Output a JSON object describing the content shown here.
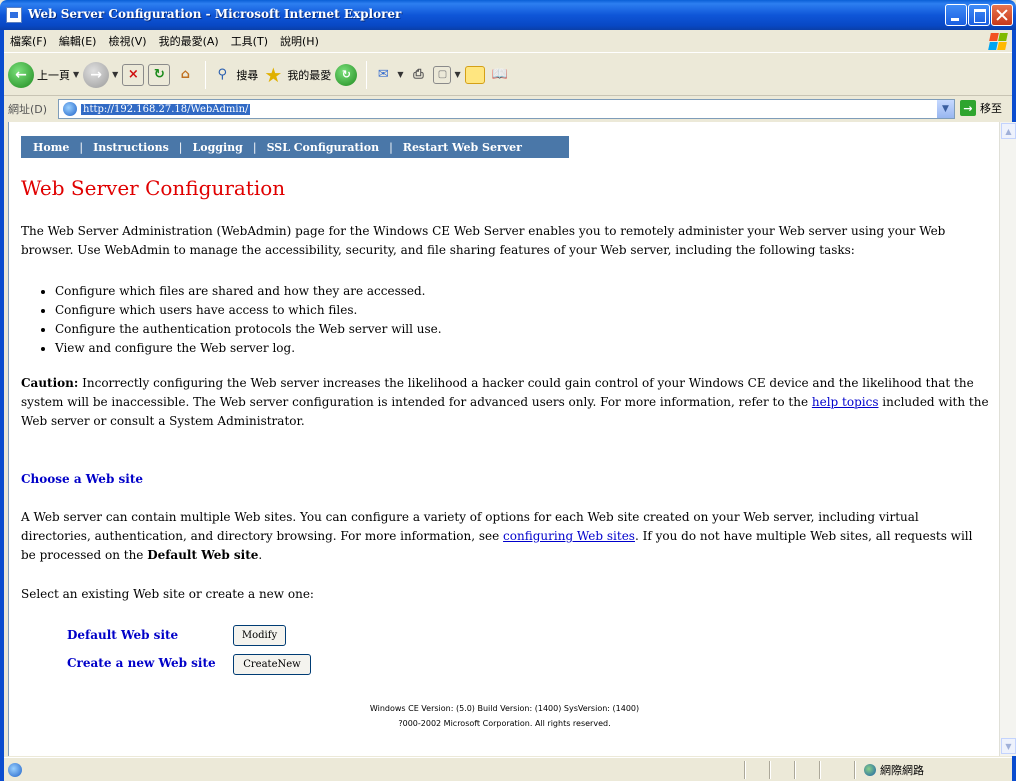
{
  "window": {
    "title": "Web Server Configuration - Microsoft Internet Explorer"
  },
  "menu": [
    "檔案(F)",
    "編輯(E)",
    "檢視(V)",
    "我的最愛(A)",
    "工具(T)",
    "說明(H)"
  ],
  "toolbar": {
    "back_label": "上一頁",
    "search_label": "搜尋",
    "favorites_label": "我的最愛"
  },
  "address": {
    "label": "網址(D)",
    "url": "http://192.168.27.18/WebAdmin/",
    "go_label": "移至"
  },
  "nav": [
    "Home",
    "Instructions",
    "Logging",
    "SSL Configuration",
    "Restart Web Server"
  ],
  "page": {
    "title": "Web Server Configuration",
    "intro": "The Web Server Administration (WebAdmin) page for the Windows CE Web Server enables you to remotely administer your Web server using your Web browser. Use WebAdmin to manage the accessibility, security, and file sharing features of your Web server, including the following tasks:",
    "tasks": [
      "Configure which files are shared and how they are accessed.",
      "Configure which users have access to which files.",
      "Configure the authentication protocols the Web server will use.",
      "View and configure the Web server log."
    ],
    "caution_label": "Caution:",
    "caution_text": " Incorrectly configuring the Web server increases the likelihood a hacker could gain control of your Windows CE device and the likelihood that the system will be inaccessible. The Web server configuration is intended for advanced users only. For more information, refer to the ",
    "caution_link": "help topics",
    "caution_tail": " included with the Web server or consult a System Administrator.",
    "choose_heading": "Choose a Web site",
    "choose_text_1": "A Web server can contain multiple Web sites. You can configure a variety of options for each Web site created on your Web server, including virtual directories, authentication, and directory browsing. For more information, see ",
    "choose_link": "configuring Web sites",
    "choose_text_2": ". If you do not have multiple Web sites, all requests will be processed on the ",
    "choose_bold": "Default Web site",
    "choose_end": ".",
    "select_text": "Select an existing Web site or create a new one:",
    "default_site_label": "Default Web site",
    "modify_button": "Modify",
    "new_site_label": "Create a new Web site",
    "createnew_button": "CreateNew",
    "footer_1": "Windows CE Version: (5.0) Build Version: (1400) SysVersion: (1400)",
    "footer_2": "?000-2002 Microsoft Corporation. All rights reserved."
  },
  "status": {
    "zone": "網際網路"
  }
}
